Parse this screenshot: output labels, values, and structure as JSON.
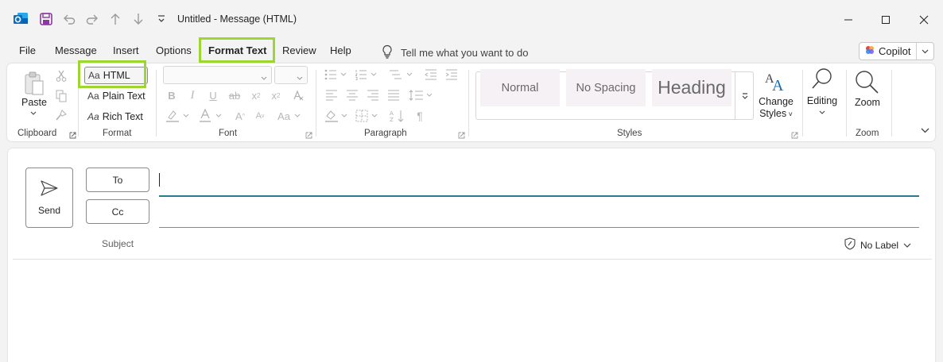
{
  "window": {
    "title": "Untitled  -  Message (HTML)"
  },
  "menu": {
    "tabs": [
      {
        "label": "File"
      },
      {
        "label": "Message"
      },
      {
        "label": "Insert"
      },
      {
        "label": "Options"
      },
      {
        "label": "Format Text"
      },
      {
        "label": "Review"
      },
      {
        "label": "Help"
      }
    ],
    "tell_me": "Tell me what you want to do",
    "copilot": "Copilot"
  },
  "ribbon": {
    "clipboard": {
      "label": "Clipboard",
      "paste": "Paste"
    },
    "format": {
      "label": "Format",
      "html": "HTML",
      "plain": "Plain Text",
      "rich": "Rich Text",
      "aa": "Aa"
    },
    "font": {
      "label": "Font"
    },
    "paragraph": {
      "label": "Paragraph"
    },
    "styles": {
      "label": "Styles",
      "normal": "Normal",
      "no_spacing": "No Spacing",
      "heading": "Heading",
      "change_styles_1": "Change",
      "change_styles_2": "Styles"
    },
    "editing": {
      "label": "Editing"
    },
    "zoom": {
      "label": "Zoom",
      "button": "Zoom"
    }
  },
  "compose": {
    "send": "Send",
    "to": "To",
    "cc": "Cc",
    "subject": "Subject",
    "sensitivity": "No Label"
  },
  "colors": {
    "highlight": "#9ed630",
    "outlook_blue": "#0f6cbd",
    "save_purple": "#8a3a9e",
    "active_line": "#2a7a8c"
  },
  "icons": {
    "app": "outlook-icon",
    "save": "save-icon",
    "undo": "undo-icon",
    "redo": "redo-icon"
  }
}
